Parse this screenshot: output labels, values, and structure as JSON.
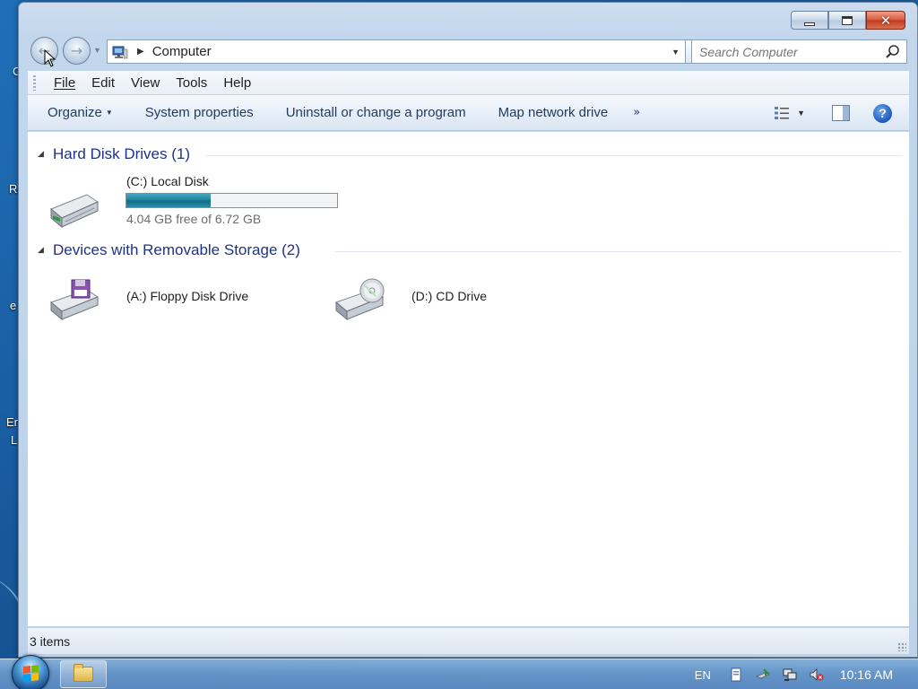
{
  "window": {
    "title": "Computer",
    "controls": {
      "minimize": "minimize",
      "maximize": "maximize",
      "close": "close"
    }
  },
  "address_bar": {
    "location": "Computer",
    "search_placeholder": "Search Computer"
  },
  "menu_bar": {
    "items": [
      "File",
      "Edit",
      "View",
      "Tools",
      "Help"
    ]
  },
  "command_bar": {
    "items": [
      "Organize",
      "System properties",
      "Uninstall or change a program",
      "Map network drive"
    ],
    "more": "»"
  },
  "groups": [
    {
      "title": "Hard Disk Drives (1)",
      "drives": [
        {
          "name": "(C:) Local Disk",
          "free_text": "4.04 GB free of 6.72 GB",
          "used_fraction": 0.399,
          "icon": "hard-disk-icon"
        }
      ]
    },
    {
      "title": "Devices with Removable Storage (2)",
      "drives": [
        {
          "name": "(A:) Floppy Disk Drive",
          "icon": "floppy-drive-icon"
        },
        {
          "name": "(D:) CD Drive",
          "icon": "cd-drive-icon"
        }
      ]
    }
  ],
  "status_bar": {
    "text": "3 items"
  },
  "taskbar": {
    "language": "EN",
    "clock": "10:16 AM"
  },
  "desktop": {
    "icon_labels": [
      "C",
      "Re",
      "e",
      "En",
      "L"
    ]
  },
  "colors": {
    "accent": "#1e3287",
    "drive_bar": "#1c7f9c",
    "desktop": "#1a5ea3"
  }
}
